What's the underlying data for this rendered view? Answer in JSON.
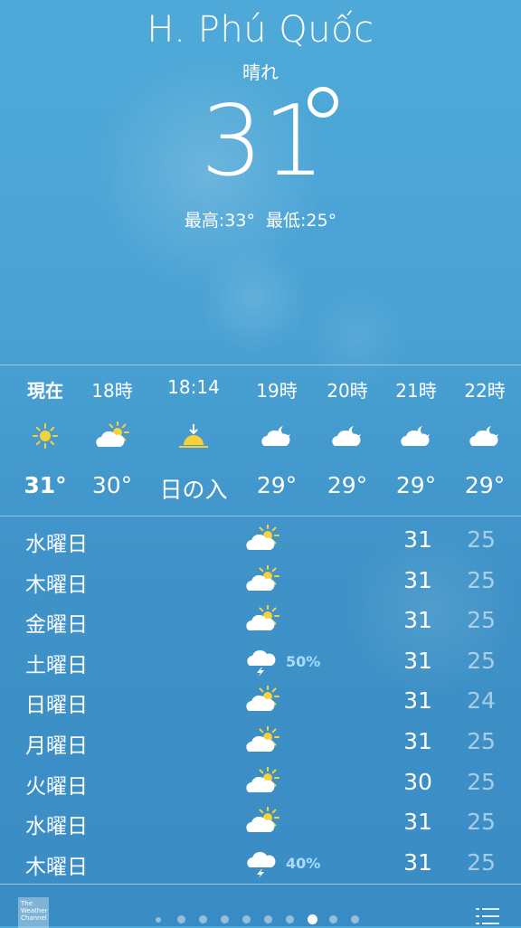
{
  "location": {
    "city": "H. Phú Quốc",
    "condition": "晴れ",
    "temperature": "31",
    "high": "最高:33°",
    "low": "最低:25°"
  },
  "hourly": [
    {
      "label": "現在",
      "icon": "sun-icon",
      "temp": "31°",
      "bold": true
    },
    {
      "label": "18時",
      "icon": "partly-cloudy-day-icon",
      "temp": "30°"
    },
    {
      "label": "18:14",
      "icon": "sunset-icon",
      "temp": "日の入"
    },
    {
      "label": "19時",
      "icon": "cloudy-night-icon",
      "temp": "29°"
    },
    {
      "label": "20時",
      "icon": "cloudy-night-icon",
      "temp": "29°"
    },
    {
      "label": "21時",
      "icon": "cloudy-night-icon",
      "temp": "29°"
    },
    {
      "label": "22時",
      "icon": "cloudy-night-icon",
      "temp": "29°"
    }
  ],
  "daily": [
    {
      "day": "水曜日",
      "icon": "partly-cloudy-day-icon",
      "precip": "",
      "high": "31",
      "low": "25"
    },
    {
      "day": "木曜日",
      "icon": "partly-cloudy-day-icon",
      "precip": "",
      "high": "31",
      "low": "25"
    },
    {
      "day": "金曜日",
      "icon": "partly-cloudy-day-icon",
      "precip": "",
      "high": "31",
      "low": "25"
    },
    {
      "day": "土曜日",
      "icon": "thunderstorm-icon",
      "precip": "50%",
      "high": "31",
      "low": "25"
    },
    {
      "day": "日曜日",
      "icon": "partly-cloudy-day-icon",
      "precip": "",
      "high": "31",
      "low": "24"
    },
    {
      "day": "月曜日",
      "icon": "partly-cloudy-day-icon",
      "precip": "",
      "high": "31",
      "low": "25"
    },
    {
      "day": "火曜日",
      "icon": "partly-cloudy-day-icon",
      "precip": "",
      "high": "30",
      "low": "25"
    },
    {
      "day": "水曜日",
      "icon": "partly-cloudy-day-icon",
      "precip": "",
      "high": "31",
      "low": "25"
    },
    {
      "day": "木曜日",
      "icon": "thunderstorm-icon",
      "precip": "40%",
      "high": "31",
      "low": "25"
    }
  ],
  "footer": {
    "logo_text": "The Weather Channel",
    "page_count": 10,
    "active_page": 8
  },
  "colors": {
    "background": "#4aa2d4",
    "sun": "#f7d13b",
    "precip": "#a9dcff"
  }
}
